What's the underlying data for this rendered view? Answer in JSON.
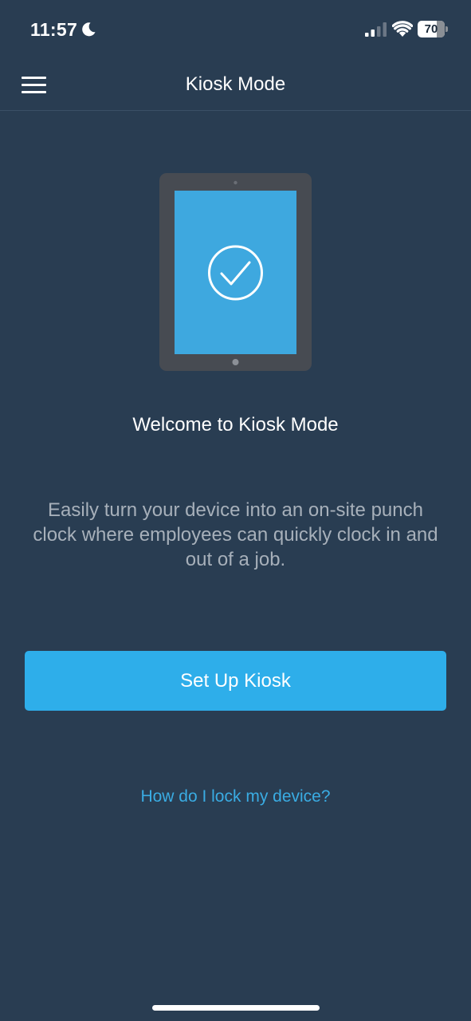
{
  "status_bar": {
    "time": "11:57",
    "battery_level": "70",
    "icons": [
      "moon-icon",
      "cellular-signal-icon",
      "wifi-icon",
      "battery-icon"
    ]
  },
  "nav": {
    "title": "Kiosk Mode",
    "menu_icon": "hamburger-menu-icon"
  },
  "illustration": {
    "icon": "tablet-checkmark-illustration",
    "screen_color": "#3ea8df",
    "frame_color": "#474b52"
  },
  "main": {
    "welcome_title": "Welcome to Kiosk Mode",
    "description": "Easily turn your device into an on-site punch clock where employees can quickly clock in and out of a job.",
    "setup_button_label": "Set Up Kiosk",
    "help_link": "How do I lock my device?"
  },
  "colors": {
    "background": "#293d52",
    "accent": "#2eaeea",
    "link": "#3aace3",
    "muted_text": "#a7b0ba"
  }
}
